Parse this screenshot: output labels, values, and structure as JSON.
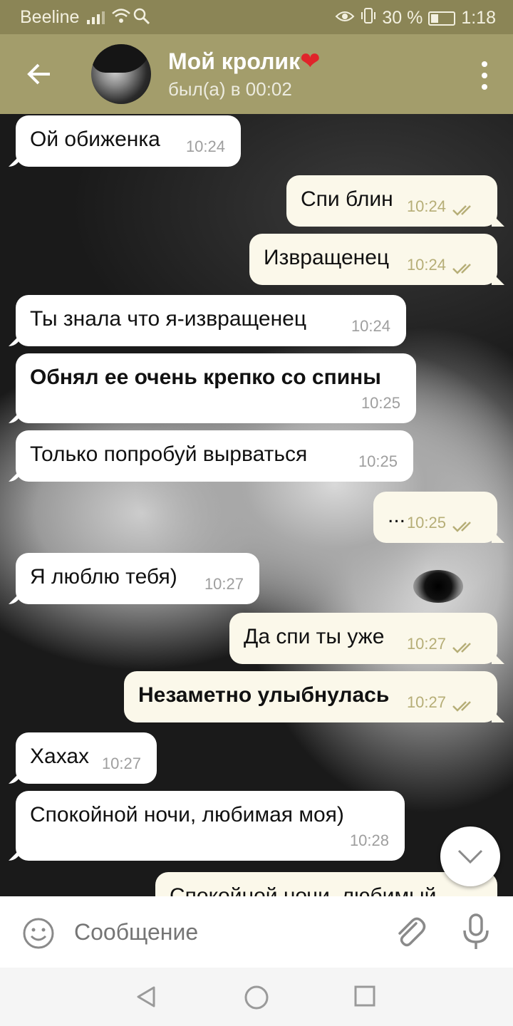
{
  "status": {
    "carrier": "Beeline",
    "battery": "30 %",
    "time": "1:18"
  },
  "header": {
    "name": "Мой кролик",
    "heart": "❤",
    "last_seen": "был(а) в 00:02"
  },
  "messages": [
    {
      "dir": "in",
      "text": "Ой обиженка",
      "time": "10:24"
    },
    {
      "dir": "out",
      "text": "Спи блин",
      "time": "10:24"
    },
    {
      "dir": "out",
      "text": "Извращенец",
      "time": "10:24"
    },
    {
      "dir": "in",
      "text": "Ты знала что я-извращенец",
      "time": "10:24"
    },
    {
      "dir": "in",
      "text": "Обнял ее очень крепко со спины",
      "time": "10:25"
    },
    {
      "dir": "in",
      "text": "Только попробуй вырваться",
      "time": "10:25"
    },
    {
      "dir": "out",
      "text": "...",
      "time": "10:25"
    },
    {
      "dir": "in",
      "text": "Я люблю тебя)",
      "time": "10:27"
    },
    {
      "dir": "out",
      "text": "Да спи ты уже",
      "time": "10:27"
    },
    {
      "dir": "out",
      "text": "Незаметно улыбнулась",
      "time": "10:27"
    },
    {
      "dir": "in",
      "text": "Хахах",
      "time": "10:27"
    },
    {
      "dir": "in",
      "text": "Спокойной ночи, любимая моя)",
      "time": "10:28"
    },
    {
      "dir": "out",
      "text": "Спокойной ночи, любимый",
      "time": ""
    }
  ],
  "input": {
    "placeholder": "Сообщение"
  }
}
